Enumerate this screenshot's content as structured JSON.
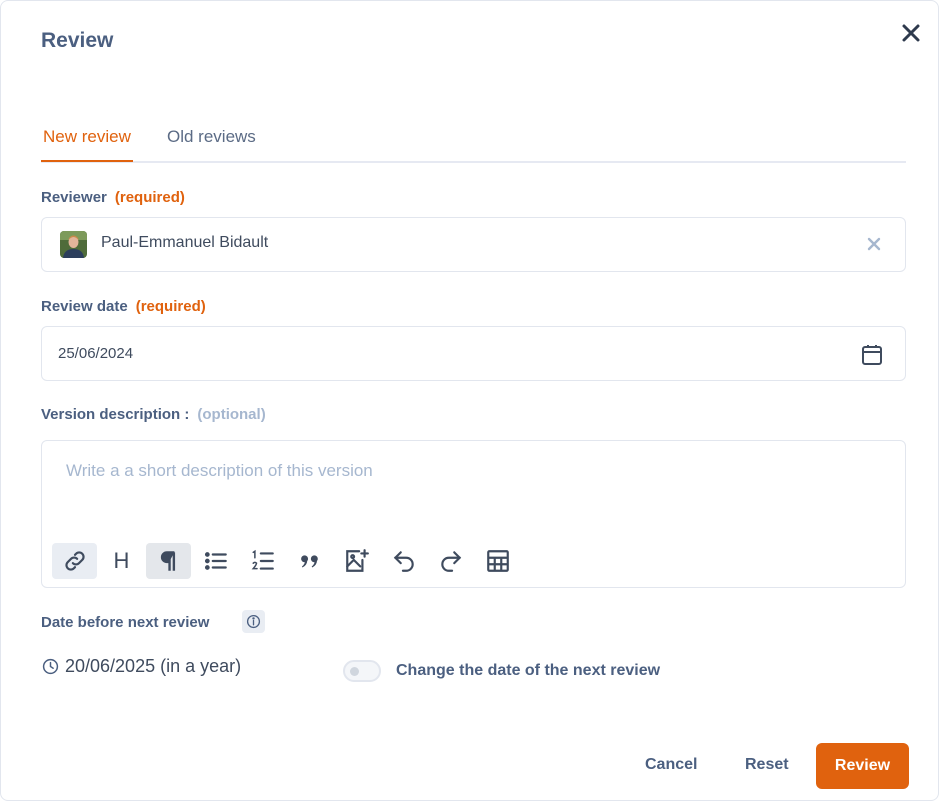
{
  "dialog": {
    "title": "Review"
  },
  "tabs": [
    {
      "label": "New review",
      "active": true
    },
    {
      "label": "Old reviews",
      "active": false
    }
  ],
  "reviewer": {
    "label": "Reviewer",
    "required_text": "(required)",
    "value": "Paul-Emmanuel Bidault"
  },
  "review_date": {
    "label": "Review date",
    "required_text": "(required)",
    "value": "25/06/2024"
  },
  "description": {
    "label": "Version description :",
    "optional_text": "(optional)",
    "placeholder": "Write a a short description of this version",
    "value": ""
  },
  "toolbar": {
    "heading_glyph": "H",
    "icons": [
      "link-icon",
      "heading-icon",
      "paragraph-icon",
      "bullet-list-icon",
      "ordered-list-icon",
      "quote-icon",
      "image-icon",
      "undo-icon",
      "redo-icon",
      "table-icon"
    ]
  },
  "next_review": {
    "label": "Date before next review",
    "value": "20/06/2025 (in a year)",
    "toggle_label": "Change the date of the next review",
    "toggle_on": false
  },
  "actions": {
    "cancel": "Cancel",
    "reset": "Reset",
    "review": "Review"
  },
  "colors": {
    "accent": "#e0620e",
    "label": "#4b5f80",
    "optional": "#a6b7cf"
  }
}
